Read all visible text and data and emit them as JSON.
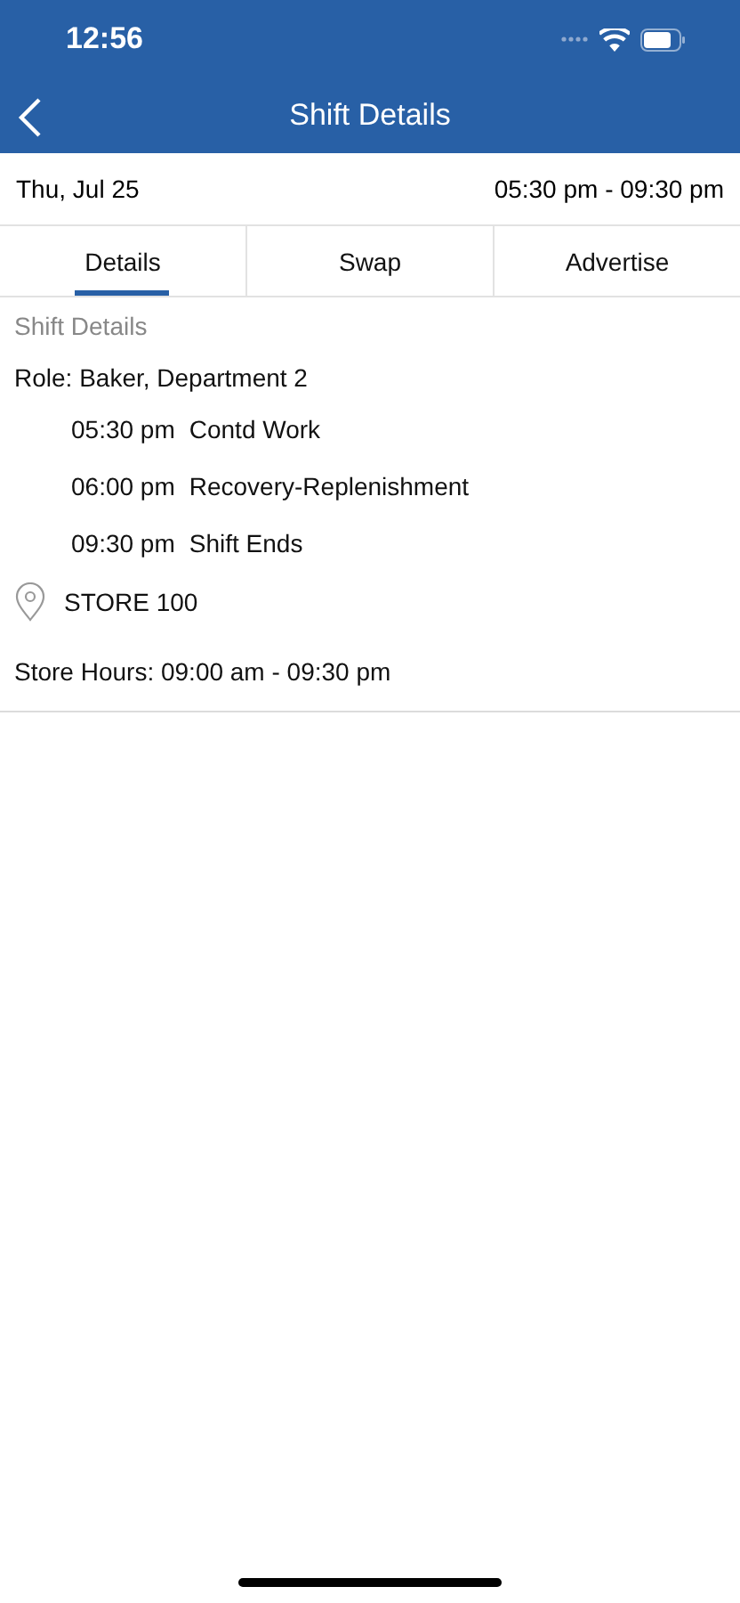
{
  "status_bar": {
    "time": "12:56"
  },
  "nav": {
    "title": "Shift Details"
  },
  "summary": {
    "date": "Thu, Jul 25",
    "hours": "05:30 pm - 09:30 pm"
  },
  "tabs": [
    {
      "label": "Details",
      "selected": true
    },
    {
      "label": "Swap",
      "selected": false
    },
    {
      "label": "Advertise",
      "selected": false
    }
  ],
  "section_title": "Shift Details",
  "role": "Role: Baker, Department 2",
  "schedule": [
    {
      "time": "05:30 pm",
      "activity": "Contd Work"
    },
    {
      "time": "06:00 pm",
      "activity": "Recovery-Replenishment"
    },
    {
      "time": "09:30 pm",
      "activity": "Shift Ends"
    }
  ],
  "location": "STORE 100",
  "store_hours": "Store Hours: 09:00 am - 09:30 pm"
}
